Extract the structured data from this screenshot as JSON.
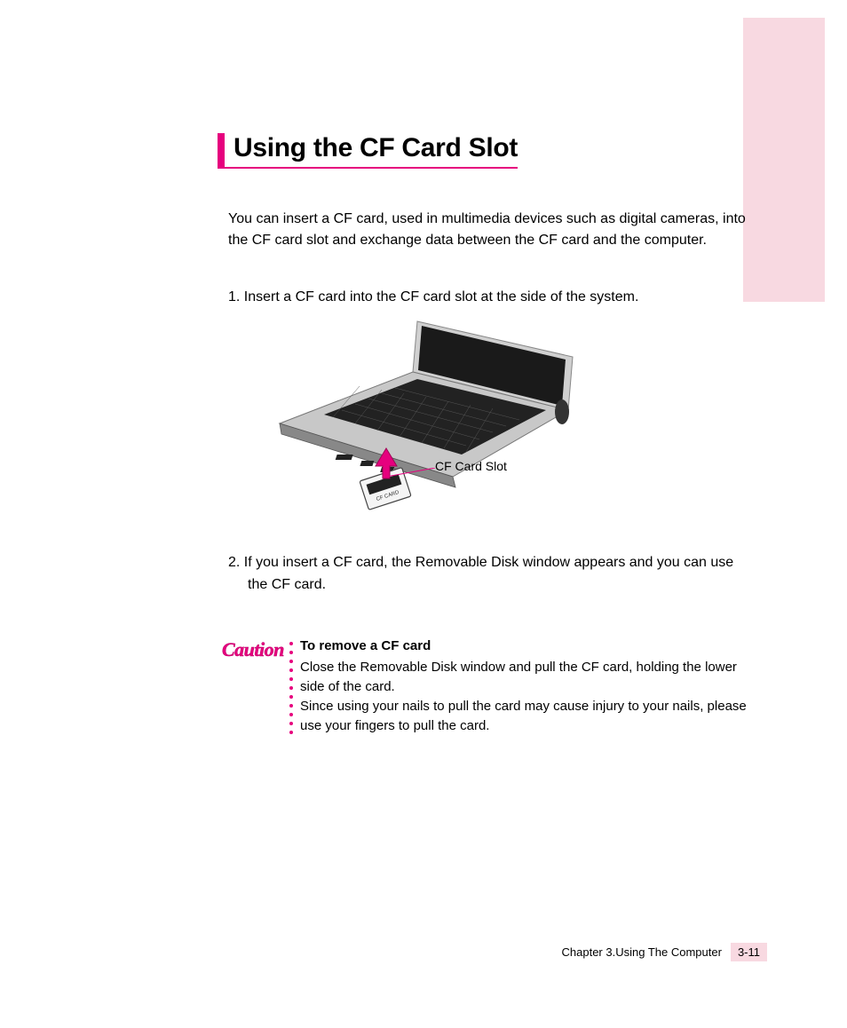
{
  "title": "Using the CF Card Slot",
  "intro": "You can insert a CF card, used in multimedia devices such as digital cameras, into the CF card slot and exchange data between the CF card and the computer.",
  "step1": "1.  Insert a CF card into the CF card slot at the side of the system.",
  "figure_callout": "CF Card Slot",
  "step2": "2.   If you insert a CF card, the Removable Disk window appears and you can use the CF card.",
  "caution_label": "Caution",
  "caution_title": "To remove a CF card",
  "caution_body_1": "Close the Removable Disk window and pull the CF card, holding the lower side of the card.",
  "caution_body_2": "Since using your nails to pull the card may cause injury to your nails, please use your fingers to pull the card.",
  "footer_chapter": "Chapter 3.Using The Computer",
  "footer_page": "3-11"
}
